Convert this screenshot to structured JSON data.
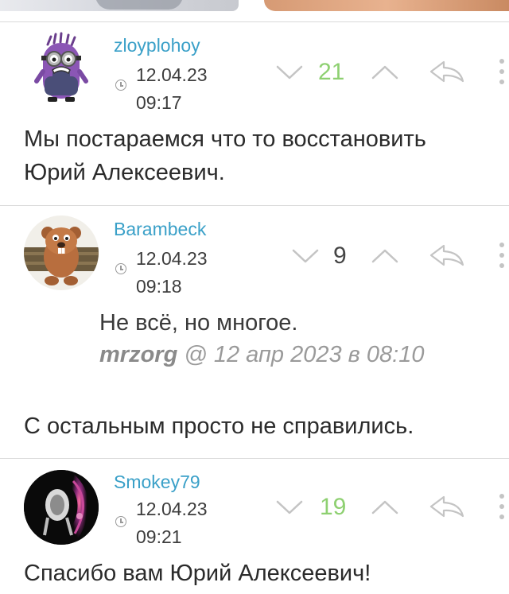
{
  "comments": [
    {
      "username": "zloyplohoy",
      "date": "12.04.23",
      "time": "09:17",
      "score": "21",
      "text_lines": [
        "Мы постараемся что то восстановить",
        "Юрий Алексеевич."
      ],
      "colors": {
        "score": "#8ed071"
      }
    },
    {
      "username": "Barambeck",
      "date": "12.04.23",
      "time": "09:18",
      "score": "9",
      "quote": {
        "text": "Не всё, но многое.",
        "author": "mrzorg",
        "at": "@ 12 апр 2023 в 08:10"
      },
      "text_lines": [
        "С остальным просто не справились."
      ],
      "colors": {
        "score": "#454545"
      }
    },
    {
      "username": "Smokey79",
      "date": "12.04.23",
      "time": "09:21",
      "score": "19",
      "text_lines": [
        "Спасибо вам Юрий Алексеевич!"
      ],
      "colors": {
        "score": "#8ed071"
      }
    }
  ],
  "icons": [
    "downvote-icon",
    "upvote-icon",
    "reply-icon",
    "more-icon",
    "clock-icon"
  ],
  "theme": {
    "username": "#3aa0c8",
    "divider": "#dadada",
    "icon": "#c4c4c4"
  }
}
